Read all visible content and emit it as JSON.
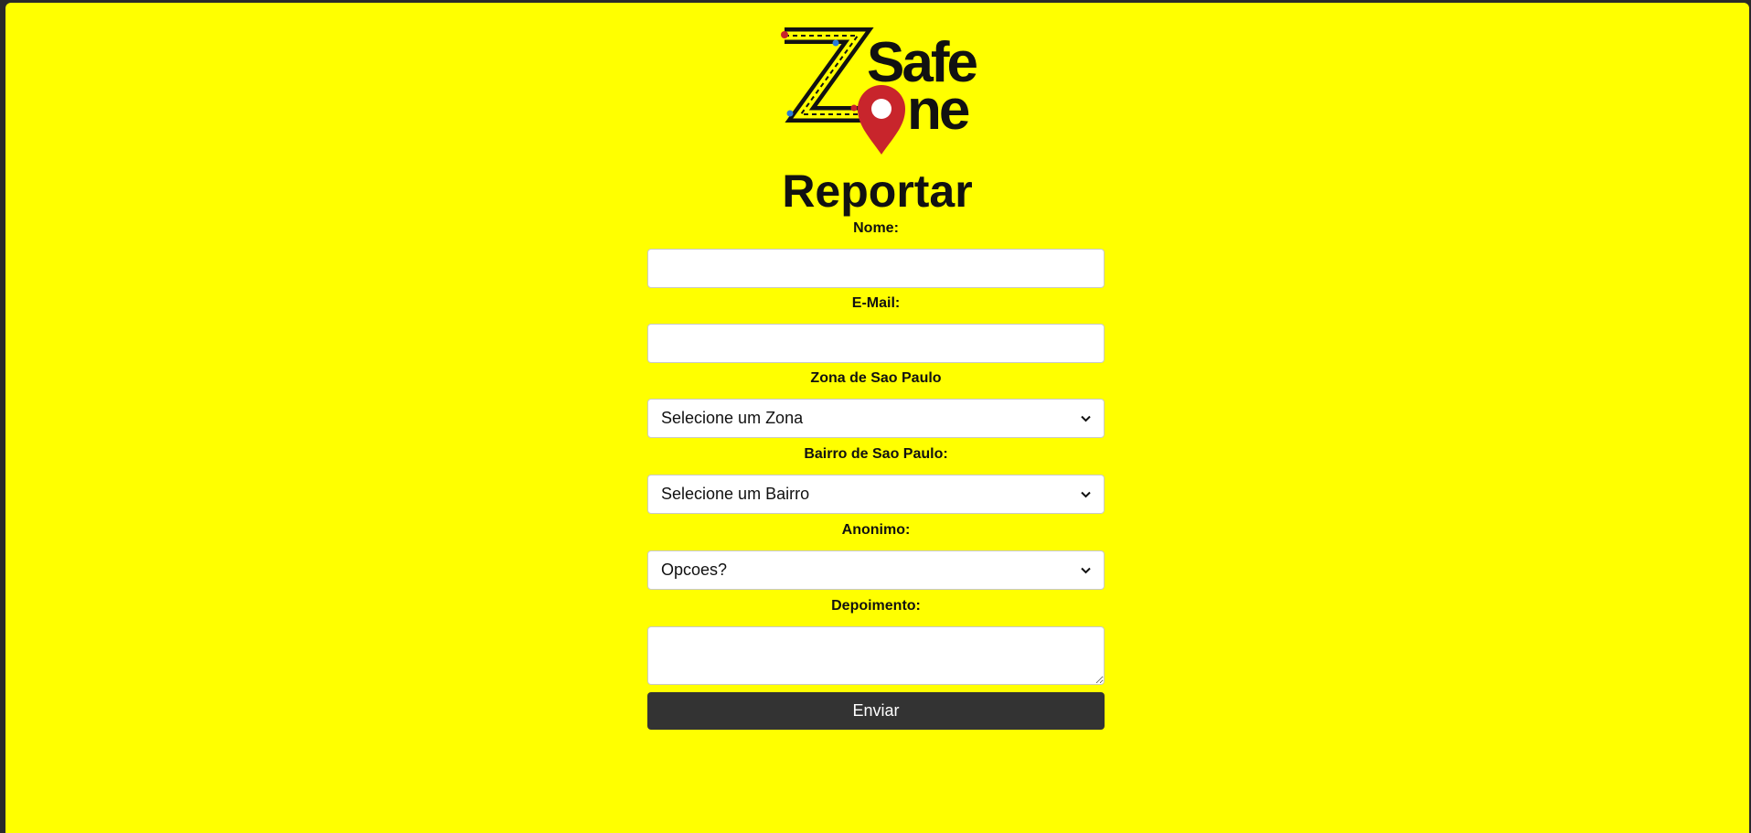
{
  "brand": {
    "logo_text_line1": "Safe",
    "logo_text_line2": "ne",
    "logo_letter": "Z",
    "colors": {
      "background": "#ffff00",
      "pin": "#c8252c",
      "text": "#111111"
    }
  },
  "page_title": "Reportar",
  "form": {
    "nome": {
      "label": "Nome:",
      "value": "",
      "placeholder": ""
    },
    "email": {
      "label": "E-Mail:",
      "value": "",
      "placeholder": ""
    },
    "zona": {
      "label": "Zona de Sao Paulo",
      "selected": "Selecione um Zona"
    },
    "bairro": {
      "label": "Bairro de Sao Paulo:",
      "selected": "Selecione um Bairro"
    },
    "anonimo": {
      "label": "Anonimo:",
      "selected": "Opcoes?"
    },
    "depoimento": {
      "label": "Depoimento:",
      "value": ""
    },
    "submit_label": "Enviar"
  },
  "colors": {
    "button_bg": "#333333",
    "button_text": "#ffffff"
  }
}
